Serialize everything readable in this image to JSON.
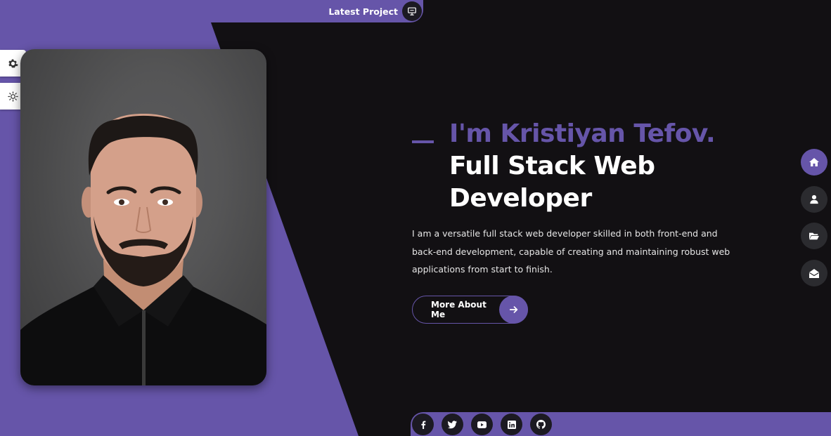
{
  "top_bar": {
    "label": "Latest Project",
    "icon": "presentation-icon"
  },
  "side_panel": {
    "items": [
      {
        "icon": "gear-icon"
      },
      {
        "icon": "sun-icon"
      }
    ]
  },
  "hero": {
    "intro": "I'm Kristiyan Tefov.",
    "role_line_1": "Full Stack Web",
    "role_line_2": "Developer",
    "description": "I am a versatile full stack web developer skilled in both front-end and back-end development, capable of creating and maintaining robust web applications from start to finish.",
    "cta_label": "More About Me"
  },
  "right_nav": [
    {
      "icon": "home-icon",
      "active": true
    },
    {
      "icon": "user-icon",
      "active": false
    },
    {
      "icon": "folder-icon",
      "active": false
    },
    {
      "icon": "envelope-open-icon",
      "active": false
    }
  ],
  "social_links": [
    "facebook-icon",
    "twitter-icon",
    "youtube-icon",
    "linkedin-icon",
    "github-icon"
  ],
  "colors": {
    "accent": "#6655a9",
    "background": "#121013",
    "dark_circle": "#2b2b2f"
  }
}
